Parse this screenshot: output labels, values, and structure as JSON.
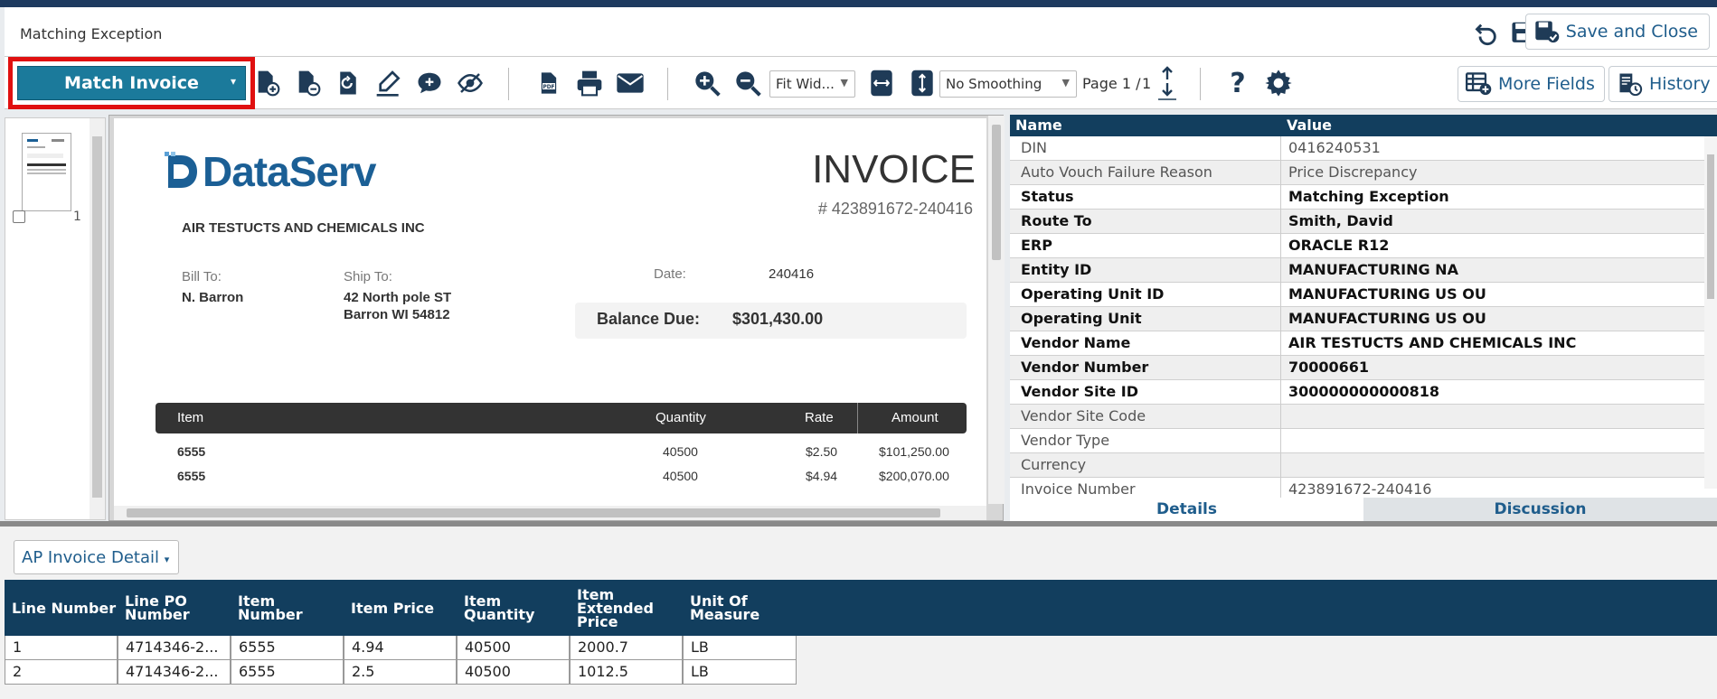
{
  "header": {
    "title": "Matching Exception",
    "save_close_label": "Save and Close"
  },
  "toolbar": {
    "match_label": "Match Invoice",
    "fit_select": "Fit Wid...",
    "smoothing_select": "No Smoothing",
    "page_label": "Page 1 /",
    "page_total": "1",
    "more_fields_label": "More Fields",
    "history_label": "History"
  },
  "thumbs": {
    "page_number": "1"
  },
  "invoice": {
    "logo_text": "DataServ",
    "title": "INVOICE",
    "number": "# 423891672-240416",
    "company": "AIR TESTUCTS AND CHEMICALS INC",
    "bill_to_label": "Bill To:",
    "bill_to_value": "N. Barron",
    "ship_to_label": "Ship To:",
    "ship_to_line1": "42 North pole ST",
    "ship_to_line2": "Barron WI 54812",
    "date_label": "Date:",
    "date_value": "240416",
    "balance_label": "Balance Due:",
    "balance_value": "$301,430.00",
    "columns": [
      "Item",
      "Quantity",
      "Rate",
      "Amount"
    ],
    "items": [
      {
        "item": "6555",
        "quantity": "40500",
        "rate": "$2.50",
        "amount": "$101,250.00"
      },
      {
        "item": "6555",
        "quantity": "40500",
        "rate": "$4.94",
        "amount": "$200,070.00"
      }
    ]
  },
  "fields": {
    "col_name": "Name",
    "col_value": "Value",
    "rows": [
      {
        "name": "DIN",
        "value": "0416240531"
      },
      {
        "name": "Auto Vouch Failure Reason",
        "value": "Price Discrepancy"
      },
      {
        "name": "Status",
        "value": "Matching Exception"
      },
      {
        "name": "Route To",
        "value": "Smith, David"
      },
      {
        "name": "ERP",
        "value": "ORACLE R12"
      },
      {
        "name": "Entity ID",
        "value": "MANUFACTURING NA"
      },
      {
        "name": "Operating Unit ID",
        "value": "MANUFACTURING US OU"
      },
      {
        "name": "Operating Unit",
        "value": "MANUFACTURING US OU"
      },
      {
        "name": "Vendor Name",
        "value": "AIR TESTUCTS AND CHEMICALS INC"
      },
      {
        "name": "Vendor Number",
        "value": "70000661"
      },
      {
        "name": "Vendor Site ID",
        "value": "300000000000818"
      },
      {
        "name": "Vendor Site Code",
        "value": ""
      },
      {
        "name": "Vendor Type",
        "value": ""
      },
      {
        "name": "Currency",
        "value": ""
      },
      {
        "name": "Invoice Number",
        "value": "423891672-240416"
      }
    ],
    "tab_details": "Details",
    "tab_discussion": "Discussion"
  },
  "bottom": {
    "dropdown_label": "AP Invoice Detail",
    "headers": [
      "Line Number",
      "Line PO Number",
      "Item Number",
      "Item Price",
      "Item Quantity",
      "Item Extended Price",
      "Unit Of Measure"
    ],
    "rows": [
      [
        "1",
        "4714346-2...",
        "6555",
        "4.94",
        "40500",
        "2000.7",
        "LB"
      ],
      [
        "2",
        "4714346-2...",
        "6555",
        "2.5",
        "40500",
        "1012.5",
        "LB"
      ]
    ]
  }
}
